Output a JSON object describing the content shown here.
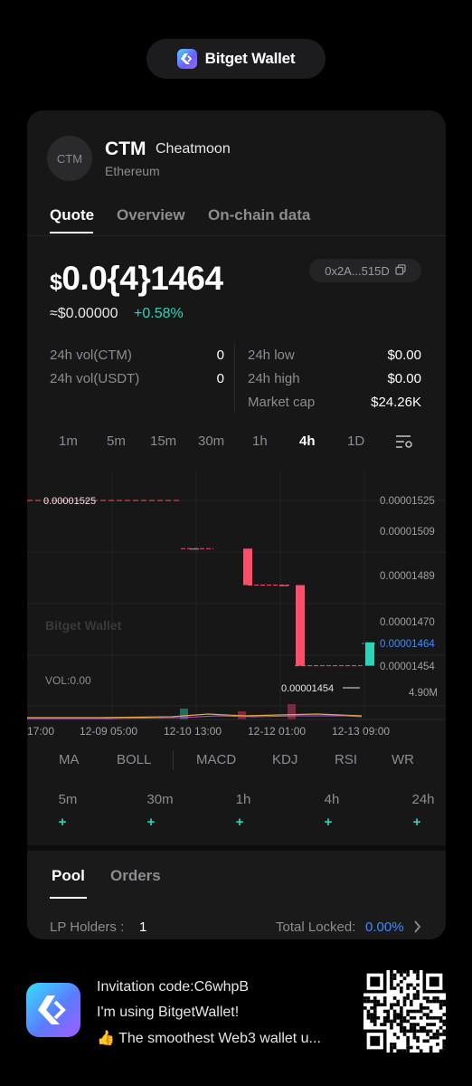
{
  "brand": {
    "title": "Bitget Wallet"
  },
  "token": {
    "avatar_text": "CTM",
    "symbol": "CTM",
    "name": "Cheatmoon",
    "chain": "Ethereum"
  },
  "tabs": [
    {
      "label": "Quote"
    },
    {
      "label": "Overview"
    },
    {
      "label": "On-chain data"
    }
  ],
  "quote": {
    "currency": "$",
    "price": "0.0{4}1464",
    "address": "0x2A...515D",
    "usd_value": "≈$0.00000",
    "change": "+0.58%",
    "change_color": "#2fd4b6"
  },
  "stats": {
    "left": [
      {
        "label": "24h vol(CTM)",
        "value": "0"
      },
      {
        "label": "24h vol(USDT)",
        "value": "0"
      }
    ],
    "right": [
      {
        "label": "24h low",
        "value": "$0.00"
      },
      {
        "label": "24h high",
        "value": "$0.00"
      },
      {
        "label": "Market cap",
        "value": "$24.26K"
      }
    ]
  },
  "timeframes": [
    "1m",
    "5m",
    "15m",
    "30m",
    "1h",
    "4h",
    "1D"
  ],
  "active_timeframe": "4h",
  "chart": {
    "watermark": "Bitget Wallet",
    "price_labels": [
      "0.00001525",
      "0.00001509",
      "0.00001489",
      "0.00001470",
      "0.00001464",
      "0.00001454"
    ],
    "high_marker": "0.00001525",
    "low_marker": "0.00001454",
    "current_price": "0.00001464",
    "vol_label": "VOL:0.00",
    "vol_max": "4.90M",
    "time_labels": [
      "17:00",
      "12-09 05:00",
      "12-10 13:00",
      "12-12 01:00",
      "12-13 09:00"
    ]
  },
  "chart_data": {
    "type": "candlestick",
    "x": [
      "12-10 13:00",
      "12-11 05:00",
      "12-12 01:00",
      "12-12 17:00",
      "12-13 09:00"
    ],
    "candles": [
      {
        "open": 1.5e-05,
        "high": 1.5e-05,
        "low": 1.5e-05,
        "close": 1.5e-05
      },
      {
        "open": 1.5e-05,
        "high": 1.5e-05,
        "low": 1.486e-05,
        "close": 1.486e-05
      },
      {
        "open": 1.486e-05,
        "high": 1.486e-05,
        "low": 1.486e-05,
        "close": 1.486e-05
      },
      {
        "open": 1.486e-05,
        "high": 1.486e-05,
        "low": 1.455e-05,
        "close": 1.455e-05
      },
      {
        "open": 1.455e-05,
        "high": 1.464e-05,
        "low": 1.455e-05,
        "close": 1.464e-05
      }
    ],
    "yticks": [
      1.525e-05,
      1.509e-05,
      1.489e-05,
      1.47e-05,
      1.454e-05
    ],
    "ylim": [
      1.45e-05,
      1.53e-05
    ],
    "up_color": "#2fd4b6",
    "down_color": "#ff4d6a"
  },
  "indicators": [
    "MA",
    "BOLL",
    "MACD",
    "KDJ",
    "RSI",
    "WR"
  ],
  "periods": [
    {
      "label": "5m",
      "value": "+"
    },
    {
      "label": "30m",
      "value": "+"
    },
    {
      "label": "1h",
      "value": "+"
    },
    {
      "label": "4h",
      "value": "+"
    },
    {
      "label": "24h",
      "value": "+"
    }
  ],
  "pool": {
    "tabs": [
      "Pool",
      "Orders"
    ],
    "lp_label": "LP Holders :",
    "lp_value": "1",
    "locked_label": "Total Locked:",
    "locked_value": "0.00%"
  },
  "footer": {
    "invite": "Invitation code:C6whpB",
    "line2": "I'm using BitgetWallet!",
    "line3": "👍 The smoothest Web3 wallet u..."
  }
}
